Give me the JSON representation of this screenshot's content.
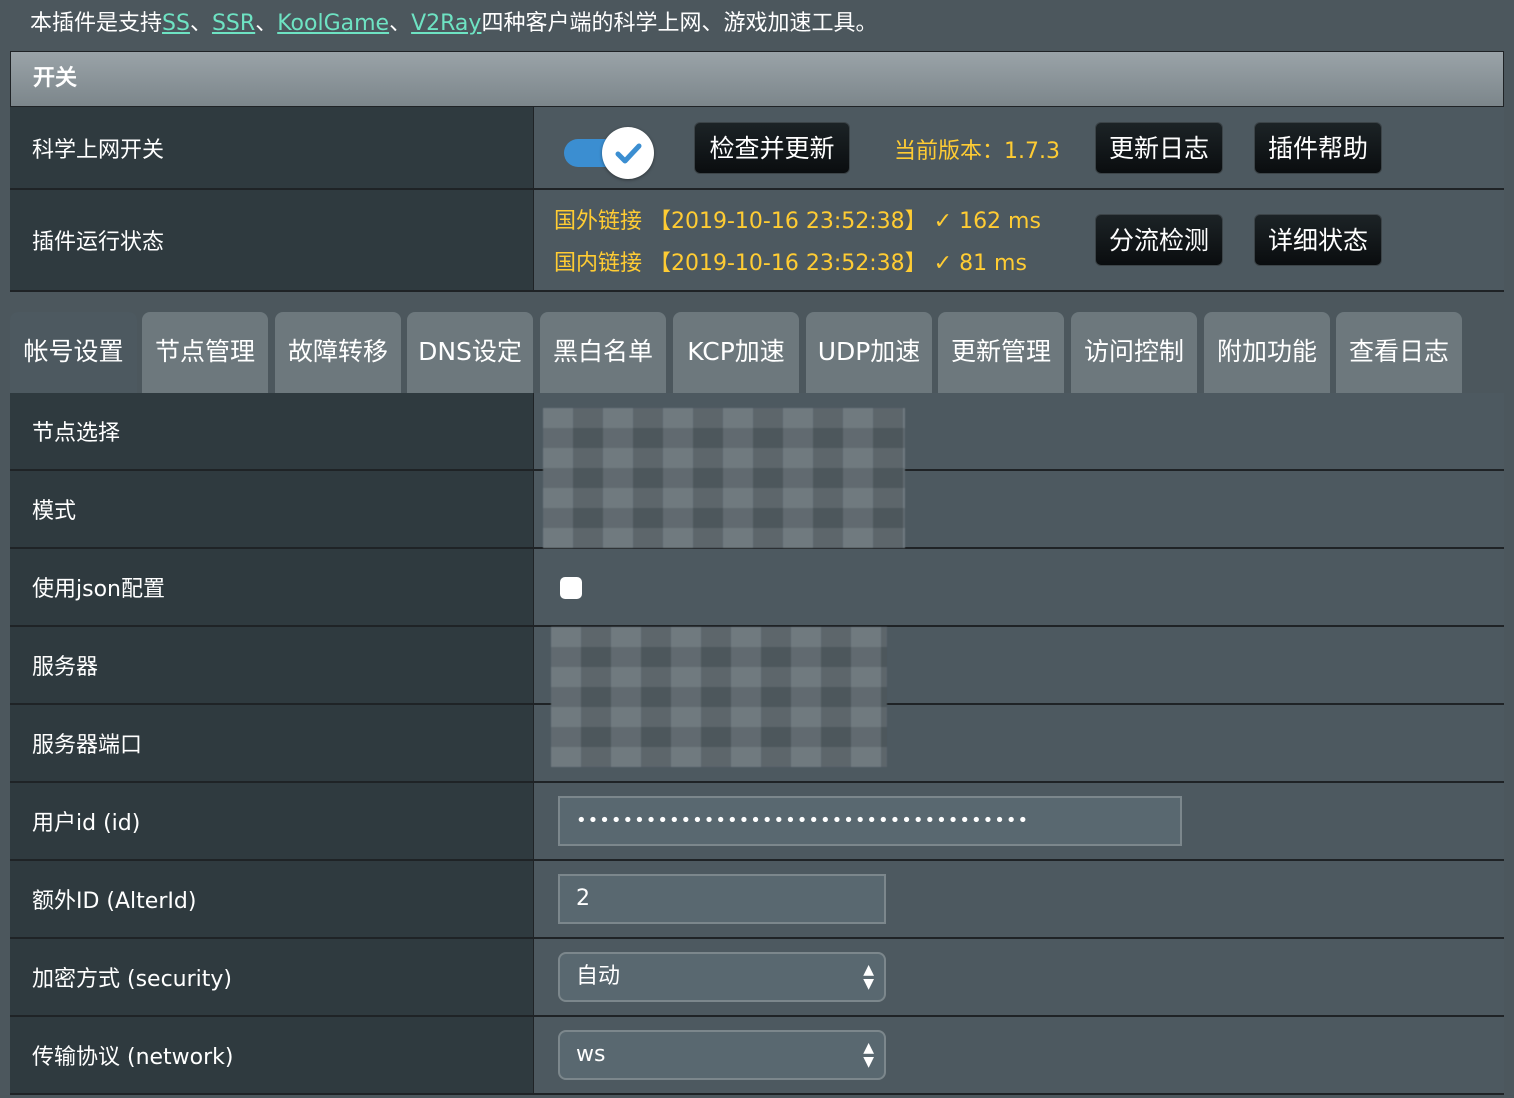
{
  "intro": {
    "prefix": "本插件是支持",
    "links": [
      "SS",
      "SSR",
      "KoolGame",
      "V2Ray"
    ],
    "sep": "、",
    "suffix": "四种客户端的科学上网、游戏加速工具。"
  },
  "panel": {
    "title": "开关"
  },
  "switch_row": {
    "label": "科学上网开关",
    "toggle_on": true,
    "check_update_label": "检查并更新",
    "version_text": "当前版本：1.7.3",
    "changelog_label": "更新日志",
    "help_label": "插件帮助"
  },
  "status_row": {
    "label": "插件运行状态",
    "foreign": "国外链接 【2019-10-16 23:52:38】 ✓ 162 ms",
    "domestic": "国内链接 【2019-10-16 23:52:38】 ✓ 81 ms",
    "split_check_label": "分流检测",
    "detail_label": "详细状态"
  },
  "tabs": [
    "帐号设置",
    "节点管理",
    "故障转移",
    "DNS设定",
    "黑白名单",
    "KCP加速",
    "UDP加速",
    "更新管理",
    "访问控制",
    "附加功能",
    "查看日志"
  ],
  "form": {
    "node_select": "节点选择",
    "mode": "模式",
    "use_json": "使用json配置",
    "server": "服务器",
    "server_port": "服务器端口",
    "user_id": "用户id (id)",
    "user_id_value": "•••••••••••••••••••••••••••••••••••••••",
    "alter_id": "额外ID (AlterId)",
    "alter_id_value": "2",
    "security": "加密方式 (security)",
    "security_value": "自动",
    "network": "传输协议 (network)",
    "network_value": "ws"
  },
  "colors": {
    "accent": "#ffcc33",
    "link": "#6ee3c3",
    "toggle": "#3b8ed1"
  }
}
